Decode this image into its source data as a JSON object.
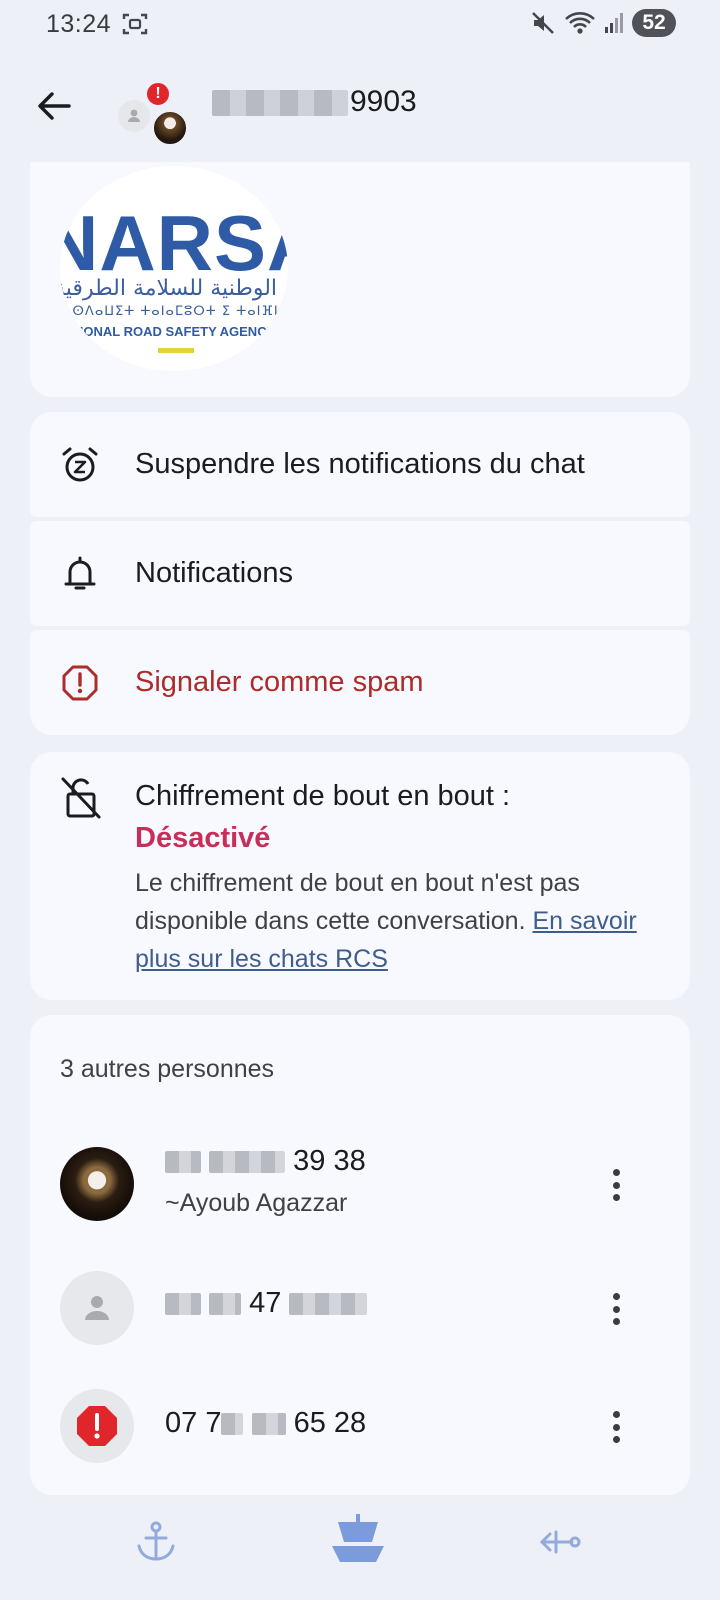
{
  "status_bar": {
    "time": "13:24",
    "battery": "52"
  },
  "header": {
    "title_suffix": "9903",
    "back_icon": "arrow-left-icon"
  },
  "logo": {
    "acronym": "NARSA",
    "arabic": "الوكالة الوطنية للسلامة الطرقية",
    "tifinagh": "ⵜⴰⵙⴷⴰⵡⵉⵜ ⵜⴰⵏⴰⵎⵓⵔⵜ ⵉ ⵜⴰⵏⴼⵍⵉⵜ",
    "english": "NATIONAL ROAD SAFETY AGENCY"
  },
  "actions": {
    "snooze": {
      "label": "Suspendre les notifications du chat",
      "icon": "alarm-snooze-icon"
    },
    "notifications": {
      "label": "Notifications",
      "icon": "bell-icon"
    },
    "spam": {
      "label": "Signaler comme spam",
      "icon": "report-octagon-icon",
      "color": "#ae2b2b"
    }
  },
  "encryption": {
    "title": "Chiffrement de bout en bout :",
    "status": "Désactivé",
    "status_color": "#c92d5a",
    "description": "Le chiffrement de bout en bout n'est pas disponible dans cette conversation.",
    "link": "En savoir plus sur les chats RCS"
  },
  "people": {
    "title": "3 autres personnes",
    "list": [
      {
        "number_visible": "39 38",
        "name": "~Ayoub Agazzar"
      },
      {
        "number_visible": "47"
      },
      {
        "number_prefix": "07 7",
        "number_visible": "65 28"
      }
    ]
  },
  "bottom_nav": [
    "anchor-icon",
    "ship-icon",
    "sign-icon"
  ]
}
